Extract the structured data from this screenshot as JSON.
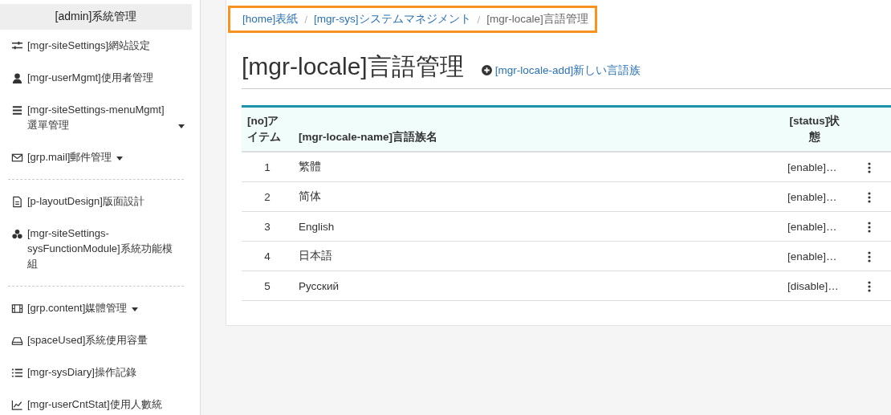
{
  "sidebar": {
    "header": "[admin]系統管理",
    "items": [
      {
        "kind": "item",
        "label": "[mgr-siteSettings]網站設定",
        "has_submenu": false
      },
      {
        "kind": "item",
        "label": "[mgr-userMgmt]使用者管理",
        "has_submenu": false
      },
      {
        "kind": "item",
        "label": "[mgr-siteSettings-menuMgmt]選單管理",
        "has_submenu": true
      },
      {
        "kind": "item",
        "label": "[grp.mail]郵件管理",
        "has_submenu": true
      },
      {
        "kind": "divider"
      },
      {
        "kind": "item",
        "label": "[p-layoutDesign]版面設計",
        "has_submenu": false
      },
      {
        "kind": "item",
        "label": "[mgr-siteSettings-sysFunctionModule]系統功能模組",
        "has_submenu": false
      },
      {
        "kind": "divider"
      },
      {
        "kind": "item",
        "label": "[grp.content]媒體管理",
        "has_submenu": true
      },
      {
        "kind": "item",
        "label": "[spaceUsed]系統使用容量",
        "has_submenu": false
      },
      {
        "kind": "item",
        "label": "[mgr-sysDiary]操作記錄",
        "has_submenu": false
      },
      {
        "kind": "item",
        "label": "[mgr-userCntStat]使用人數統",
        "has_submenu": false
      }
    ]
  },
  "breadcrumb": [
    {
      "label": "[home]表紙",
      "current": false
    },
    {
      "label": "[mgr-sys]システムマネジメント",
      "current": false
    },
    {
      "label": "[mgr-locale]言語管理",
      "current": true
    }
  ],
  "breadcrumb_separator": "/",
  "page_title": "[mgr-locale]言語管理",
  "add_link": "[mgr-locale-add]新しい言語族",
  "table": {
    "columns": [
      "[no]アイテム",
      "[mgr-locale-name]言語族名",
      "[status]状態"
    ],
    "rows": [
      {
        "no": "1",
        "name": "繁體",
        "status": "[enable]…"
      },
      {
        "no": "2",
        "name": "简体",
        "status": "[enable]…"
      },
      {
        "no": "3",
        "name": "English",
        "status": "[enable]…"
      },
      {
        "no": "4",
        "name": "日本語",
        "status": "[enable]…"
      },
      {
        "no": "5",
        "name": "Русский",
        "status": "[disable]…"
      }
    ]
  }
}
